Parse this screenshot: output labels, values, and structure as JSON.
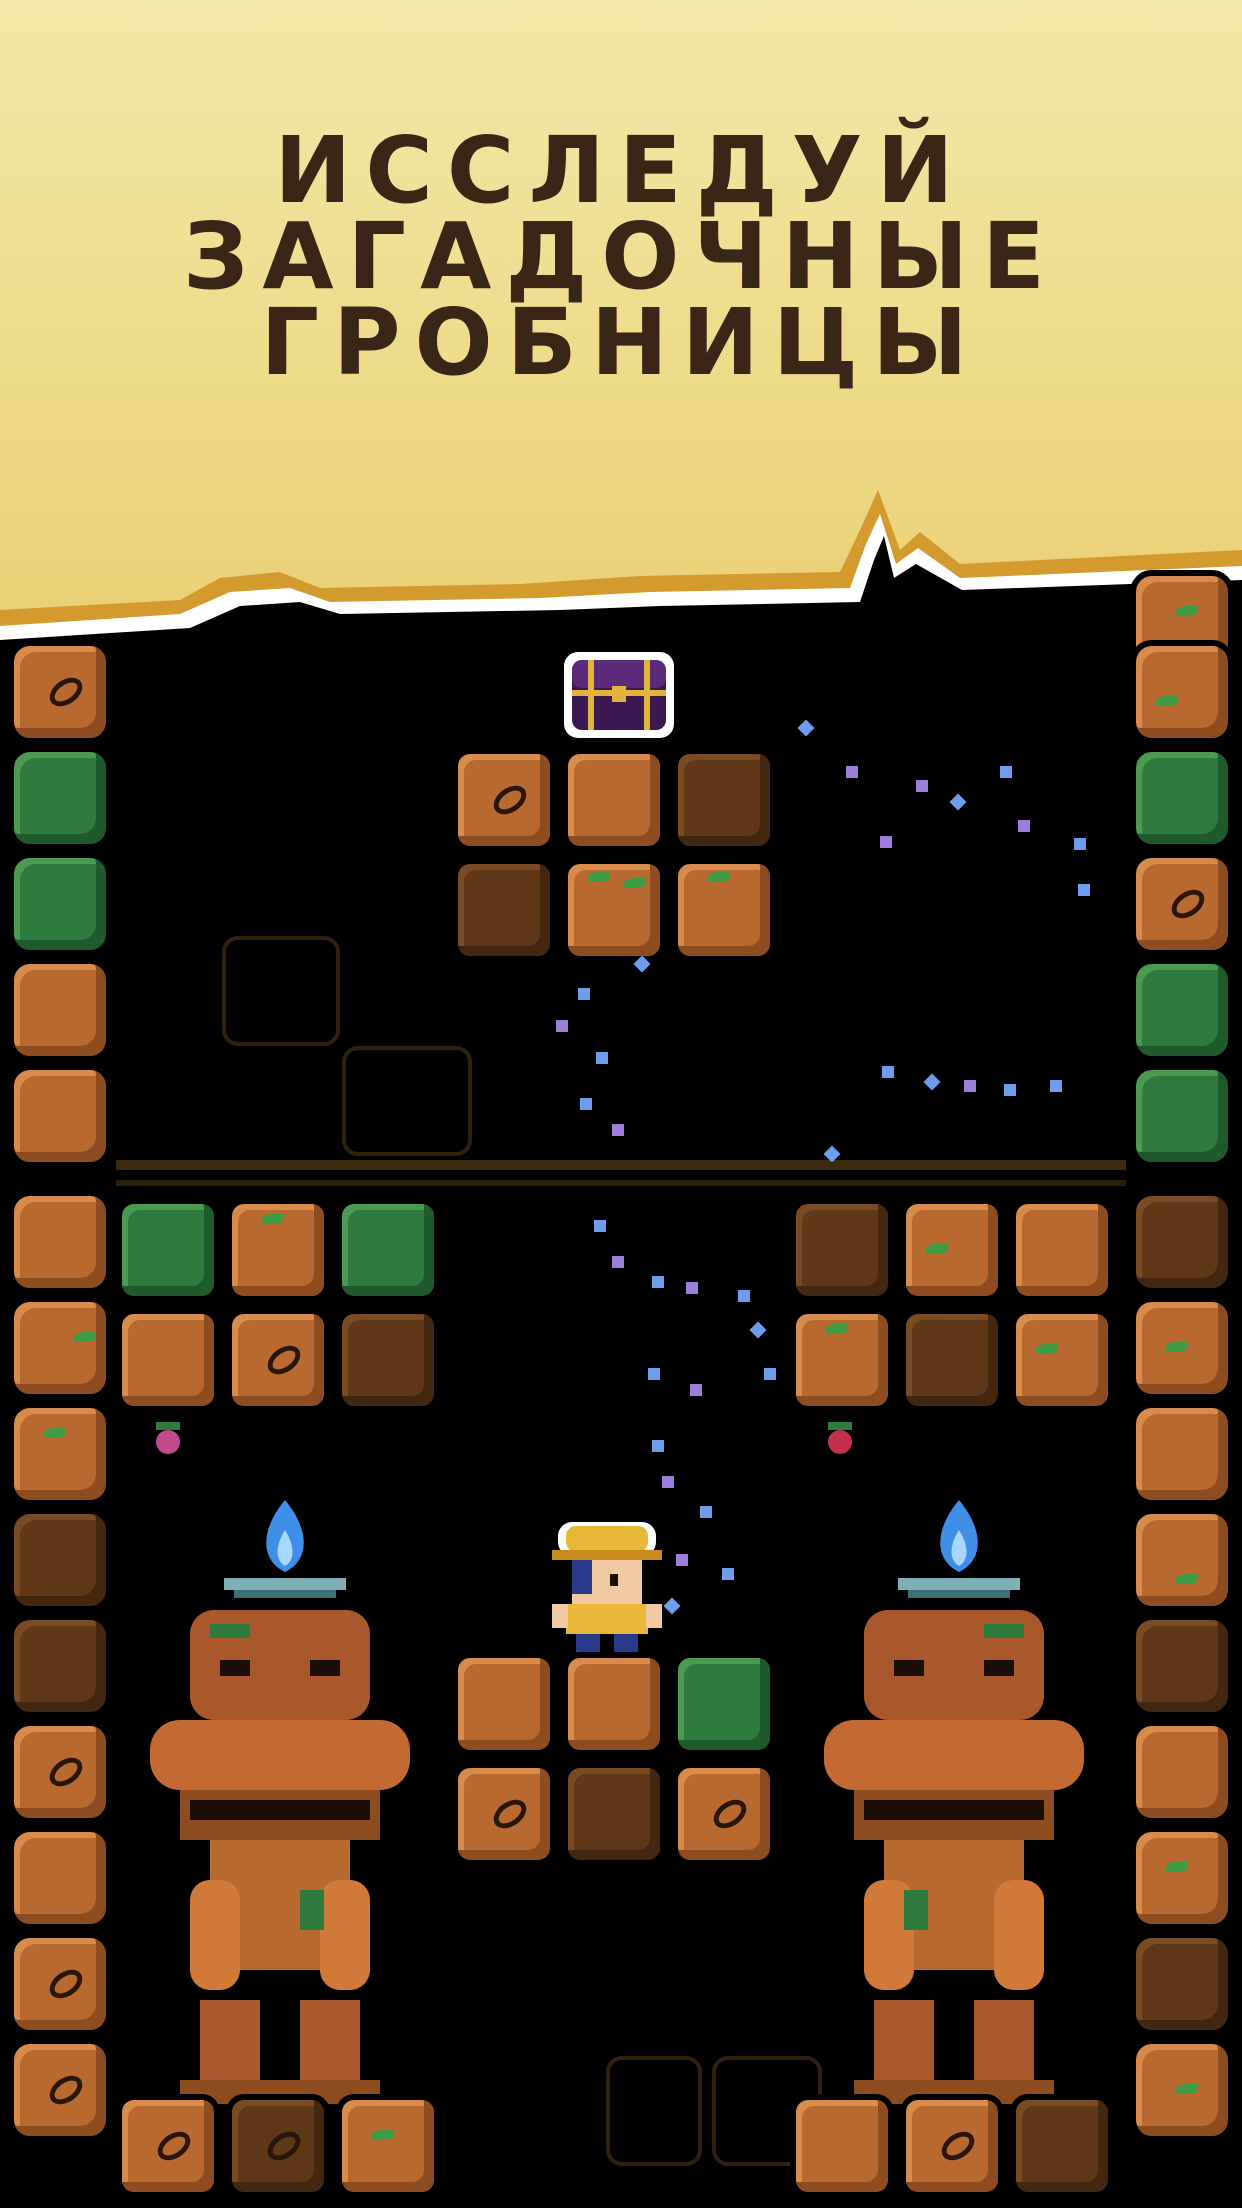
{
  "banner": {
    "headline_lines": [
      "ИССЛЕДУЙ",
      "ЗАГАДОЧНЫЕ",
      "ГРОБНИЦЫ"
    ]
  },
  "colors": {
    "banner_bg": "#eedc8c",
    "headline": "#3a2616",
    "dirt": "#b7692f",
    "dirt_dark": "#5e3817",
    "moss": "#2f7a3d",
    "flame": "#3f8fe8",
    "sparkle_blue": "#6e9df0",
    "sparkle_purple": "#9c7fd8"
  },
  "icons": {
    "chest": "treasure-chest-icon",
    "hero": "explorer-hero-sprite",
    "statue": "stone-guardian-statue",
    "torch": "blue-flame-brazier",
    "berry": "hanging-berry-icon"
  }
}
